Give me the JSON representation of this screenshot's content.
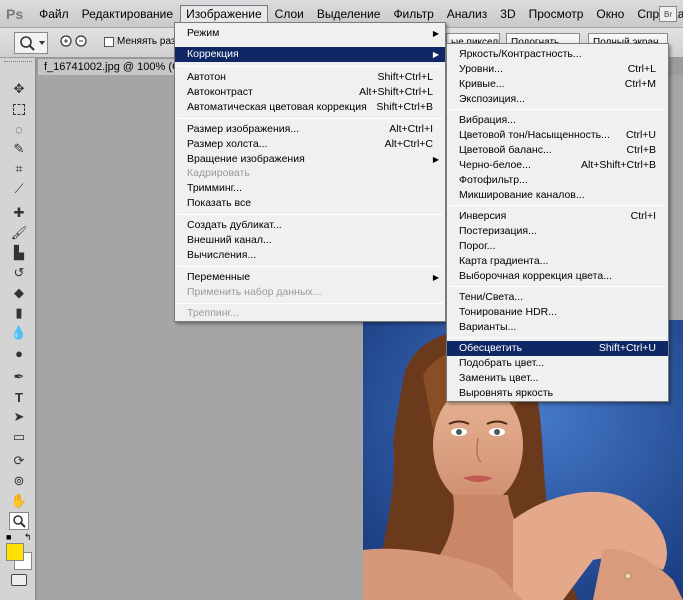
{
  "menubar": {
    "logo": "Ps",
    "items": [
      "Файл",
      "Редактирование",
      "Изображение",
      "Слои",
      "Выделение",
      "Фильтр",
      "Анализ",
      "3D",
      "Просмотр",
      "Окно",
      "Справка"
    ],
    "bridge_button": "Br"
  },
  "options": {
    "checkbox_label": "Меняять разме",
    "btn1": "Подогнать",
    "btn2": "Полный экран",
    "btn_partial": "ые пикселы"
  },
  "document": {
    "tab_title": "f_16741002.jpg @ 100% (C"
  },
  "image_menu": {
    "items": [
      {
        "label": "Режим",
        "shortcut": "",
        "submenu": true
      },
      {
        "label": "Коррекция",
        "shortcut": "",
        "submenu": true,
        "highlighted": true
      },
      {
        "label": "Автотон",
        "shortcut": "Shift+Ctrl+L"
      },
      {
        "label": "Автоконтраст",
        "shortcut": "Alt+Shift+Ctrl+L"
      },
      {
        "label": "Автоматическая цветовая коррекция",
        "shortcut": "Shift+Ctrl+B"
      },
      {
        "label": "Размер изображения...",
        "shortcut": "Alt+Ctrl+I"
      },
      {
        "label": "Размер холста...",
        "shortcut": "Alt+Ctrl+C"
      },
      {
        "label": "Вращение изображения",
        "shortcut": "",
        "submenu": true
      },
      {
        "label": "Кадрировать",
        "shortcut": "",
        "disabled": true
      },
      {
        "label": "Тримминг...",
        "shortcut": ""
      },
      {
        "label": "Показать все",
        "shortcut": ""
      },
      {
        "label": "Создать дубликат...",
        "shortcut": ""
      },
      {
        "label": "Внешний канал...",
        "shortcut": ""
      },
      {
        "label": "Вычисления...",
        "shortcut": ""
      },
      {
        "label": "Переменные",
        "shortcut": "",
        "submenu": true
      },
      {
        "label": "Применить набор данных...",
        "shortcut": "",
        "disabled": true
      },
      {
        "label": "Треппинг...",
        "shortcut": "",
        "disabled": true
      }
    ]
  },
  "correction_menu": {
    "items": [
      {
        "label": "Яркость/Контрастность...",
        "shortcut": ""
      },
      {
        "label": "Уровни...",
        "shortcut": "Ctrl+L"
      },
      {
        "label": "Кривые...",
        "shortcut": "Ctrl+M"
      },
      {
        "label": "Экспозиция...",
        "shortcut": ""
      },
      {
        "label": "Вибрация...",
        "shortcut": ""
      },
      {
        "label": "Цветовой тон/Насыщенность...",
        "shortcut": "Ctrl+U"
      },
      {
        "label": "Цветовой баланс...",
        "shortcut": "Ctrl+B"
      },
      {
        "label": "Черно-белое...",
        "shortcut": "Alt+Shift+Ctrl+B"
      },
      {
        "label": "Фотофильтр...",
        "shortcut": ""
      },
      {
        "label": "Микширование каналов...",
        "shortcut": ""
      },
      {
        "label": "Инверсия",
        "shortcut": "Ctrl+I"
      },
      {
        "label": "Постеризация...",
        "shortcut": ""
      },
      {
        "label": "Порог...",
        "shortcut": ""
      },
      {
        "label": "Карта градиента...",
        "shortcut": ""
      },
      {
        "label": "Выборочная коррекция цвета...",
        "shortcut": ""
      },
      {
        "label": "Тени/Света...",
        "shortcut": ""
      },
      {
        "label": "Тонирование HDR...",
        "shortcut": ""
      },
      {
        "label": "Варианты...",
        "shortcut": ""
      },
      {
        "label": "Обесцветить",
        "shortcut": "Shift+Ctrl+U",
        "highlighted": true
      },
      {
        "label": "Подобрать цвет...",
        "shortcut": ""
      },
      {
        "label": "Заменить цвет...",
        "shortcut": ""
      },
      {
        "label": "Выровнять яркость",
        "shortcut": ""
      }
    ]
  },
  "colors": {
    "highlight": "#0f2764",
    "foreground_swatch": "#ffe000",
    "photo_background": "#2a5aad"
  }
}
